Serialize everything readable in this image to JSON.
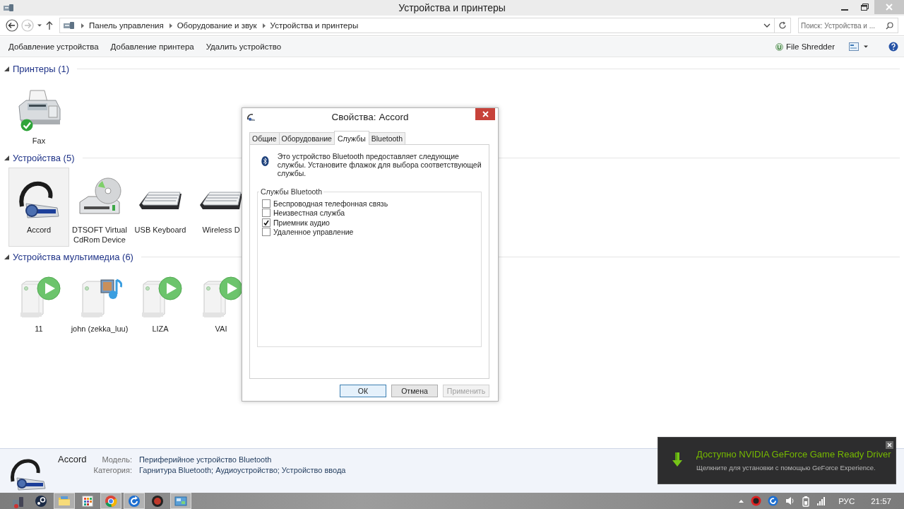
{
  "window": {
    "title": "Устройства и принтеры"
  },
  "address": {
    "breadcrumbs": [
      "Панель управления",
      "Оборудование и звук",
      "Устройства и принтеры"
    ]
  },
  "search": {
    "placeholder": "Поиск: Устройства и ..."
  },
  "toolbar": {
    "actions": [
      "Добавление устройства",
      "Добавление принтера",
      "Удалить устройство"
    ],
    "file_shredder": "File Shredder"
  },
  "groups": [
    {
      "title": "Принтеры (1)",
      "expanded": true,
      "items": [
        {
          "name": "Fax",
          "kind": "fax",
          "selected": false,
          "default": true
        }
      ]
    },
    {
      "title": "Устройства (5)",
      "expanded": true,
      "items": [
        {
          "name": "Accord",
          "kind": "headset",
          "selected": true
        },
        {
          "name": "DTSOFT Virtual CdRom Device",
          "kind": "cdrom",
          "selected": false
        },
        {
          "name": "USB Keyboard",
          "kind": "keyboard",
          "selected": false
        },
        {
          "name": "Wireless D",
          "kind": "keyboard",
          "selected": false
        }
      ]
    },
    {
      "title": "Устройства мультимедиа (6)",
      "expanded": true,
      "items": [
        {
          "name": "11",
          "kind": "media-play",
          "selected": false
        },
        {
          "name": "john (zekka_luu)",
          "kind": "media-library",
          "selected": false
        },
        {
          "name": "LIZA",
          "kind": "media-play",
          "selected": false
        },
        {
          "name": "VAI",
          "kind": "media-play",
          "selected": false
        }
      ]
    }
  ],
  "details": {
    "name": "Accord",
    "fields": [
      {
        "label": "Модель:",
        "value": "Периферийное устройство Bluetooth"
      },
      {
        "label": "Категория:",
        "value": "Гарнитура Bluetooth; Аудиоустройство; Устройство ввода"
      }
    ]
  },
  "dialog": {
    "title": "Свойства: Accord",
    "tabs": [
      {
        "label": "Общие",
        "selected": false
      },
      {
        "label": "Оборудование",
        "selected": false
      },
      {
        "label": "Службы",
        "selected": true
      },
      {
        "label": "Bluetooth",
        "selected": false
      }
    ],
    "description": "Это устройство Bluetooth предоставляет следующие службы. Установите флажок для выбора соответствующей службы.",
    "services_group": "Службы Bluetooth",
    "services": [
      {
        "label": "Беспроводная телефонная связь",
        "checked": false
      },
      {
        "label": "Неизвестная служба",
        "checked": false
      },
      {
        "label": "Приемник аудио",
        "checked": true
      },
      {
        "label": "Удаленное управление",
        "checked": false
      }
    ],
    "buttons": [
      {
        "label": "ОК",
        "default": true,
        "disabled": false
      },
      {
        "label": "Отмена",
        "default": false,
        "disabled": false
      },
      {
        "label": "Применить",
        "default": false,
        "disabled": true
      }
    ]
  },
  "notification": {
    "title": "Доступно NVIDIA GeForce Game Ready Driver",
    "message": "Щелкните для установки с помощью GeForce Experience."
  },
  "taskbar": {
    "apps": [
      {
        "kind": "devices",
        "running": false
      },
      {
        "kind": "steam",
        "running": false
      },
      {
        "kind": "explorer",
        "running": true
      },
      {
        "kind": "apps",
        "running": false
      },
      {
        "kind": "chrome",
        "running": true
      },
      {
        "kind": "refresh",
        "running": true
      },
      {
        "kind": "red",
        "running": false
      },
      {
        "kind": "control-panel",
        "running": true
      }
    ],
    "language": "РУС",
    "time": "21:57"
  }
}
